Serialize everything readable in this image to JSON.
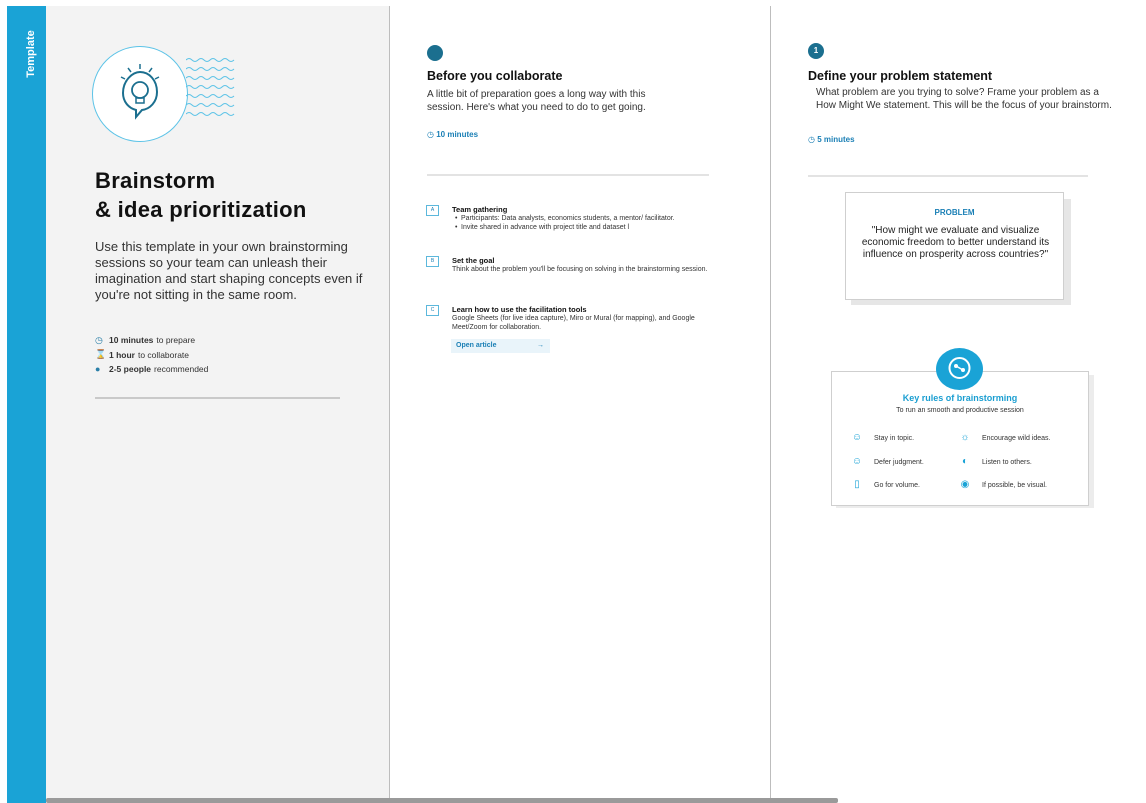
{
  "sidebar": {
    "label": "Template"
  },
  "intro": {
    "title_line1": "Brainstorm",
    "title_line2": "& idea prioritization",
    "description": "Use this template in your own brainstorming sessions so your team can unleash their imagination and start shaping concepts even if you're not sitting in the same room.",
    "meta": [
      {
        "icon": "clock-icon",
        "bold": "10 minutes",
        "text": "to prepare"
      },
      {
        "icon": "hourglass-icon",
        "bold": "1 hour",
        "text": "to collaborate"
      },
      {
        "icon": "person-icon",
        "bold": "2-5 people",
        "text": "recommended"
      }
    ]
  },
  "before": {
    "title": "Before you collaborate",
    "description": "A little bit of preparation goes a long way with this session. Here's what you need to do to get going.",
    "time": "10 minutes",
    "steps": [
      {
        "marker": "A",
        "title": "Team gathering",
        "bullets": [
          "Participants: Data analysts, economics students, a mentor/ facilitator.",
          "Invite shared in advance with project title and dataset l"
        ]
      },
      {
        "marker": "B",
        "title": "Set the goal",
        "body": "Think about the problem you'll be focusing on solving in the brainstorming session."
      },
      {
        "marker": "C",
        "title": "Learn how to use the facilitation tools",
        "body": " Google Sheets (for live idea capture), Miro or Mural (for mapping), and Google Meet/Zoom for collaboration."
      }
    ],
    "open_article": "Open article",
    "open_arrow": "→"
  },
  "define": {
    "step_number": "1",
    "title": "Define your problem statement",
    "description": "What problem are you trying to solve? Frame your problem as a How Might We statement. This will be the focus of your brainstorm.",
    "time": "5 minutes",
    "problem_label": "PROBLEM",
    "problem_text": "\"How might we evaluate and visualize economic freedom to better understand its influence on prosperity across countries?\"",
    "rules_title": "Key rules of brainstorming",
    "rules_subtitle": "To run an smooth and productive session",
    "rules": [
      {
        "icon": "face-icon",
        "label": "Stay in topic."
      },
      {
        "icon": "lightbulb-icon",
        "label": "Encourage wild ideas."
      },
      {
        "icon": "face-icon",
        "label": "Defer judgment."
      },
      {
        "icon": "ear-icon",
        "label": "Listen to others."
      },
      {
        "icon": "stack-icon",
        "label": "Go for volume."
      },
      {
        "icon": "eye-icon",
        "label": "If possible, be visual."
      }
    ]
  },
  "colors": {
    "accent": "#1aa3d6",
    "dark_accent": "#1b6f8f",
    "link": "#1a7fb5"
  }
}
